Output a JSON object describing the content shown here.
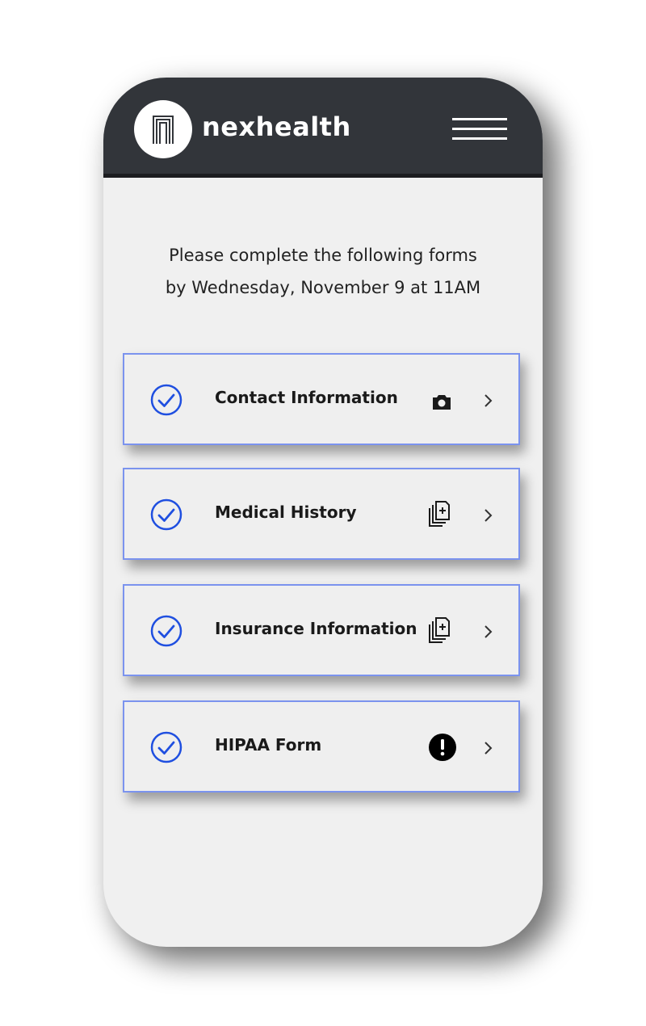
{
  "header": {
    "brand": "nexhealth",
    "logo_icon": "nexhealth-logo-icon",
    "menu_icon": "hamburger-menu-icon",
    "background_color": "#32353a"
  },
  "intro": {
    "line1": "Please complete the following forms",
    "line2": "by Wednesday, November 9 at 11AM"
  },
  "forms": [
    {
      "label": "Contact Information",
      "status_icon": "camera-icon",
      "completed": true
    },
    {
      "label": "Medical History",
      "status_icon": "add-document-icon",
      "completed": true
    },
    {
      "label": "Insurance Information",
      "status_icon": "add-document-icon",
      "completed": true
    },
    {
      "label": "HIPAA Form",
      "status_icon": "alert-icon",
      "completed": true
    }
  ],
  "colors": {
    "accent": "#1f4fe0",
    "card_border": "#7b93ee"
  }
}
